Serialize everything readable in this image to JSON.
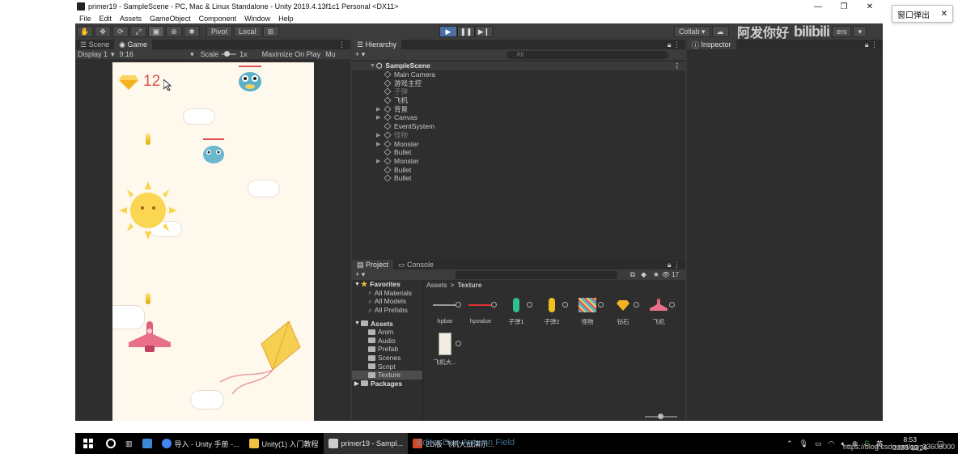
{
  "window": {
    "title": "primer19 - SampleScene - PC, Mac & Linux Standalone - Unity 2019.4.13f1c1 Personal <DX11>",
    "minimize": "—",
    "restore": "❐",
    "close": "✕"
  },
  "popout": {
    "label": "窗口弹出",
    "close": "✕"
  },
  "menu": [
    "File",
    "Edit",
    "Assets",
    "GameObject",
    "Component",
    "Window",
    "Help"
  ],
  "toolbar": {
    "pivot": "Pivot",
    "local": "Local",
    "collab": "Collab ▾",
    "layers": "ers",
    "layout": "▾"
  },
  "watermark": {
    "text": "阿发你好",
    "logo": "bilibili"
  },
  "game_tabs": {
    "scene": "Scene",
    "game": "Game"
  },
  "game_options": {
    "display": "Display 1",
    "aspect": "9:16",
    "scale_label": "Scale",
    "scale_value": "1x",
    "maximize": "Maximize On Play",
    "mute": "Mu"
  },
  "game": {
    "score": "12"
  },
  "hierarchy": {
    "tab": "Hierarchy",
    "search_placeholder": "All",
    "scene": "SampleScene",
    "items": [
      {
        "label": "Main Camera",
        "arrow": "",
        "dim": false
      },
      {
        "label": "游戏主控",
        "arrow": "",
        "dim": false
      },
      {
        "label": "子弹",
        "arrow": "",
        "dim": true
      },
      {
        "label": "飞机",
        "arrow": "",
        "dim": false
      },
      {
        "label": "背景",
        "arrow": "▶",
        "dim": false
      },
      {
        "label": "Canvas",
        "arrow": "▶",
        "dim": false
      },
      {
        "label": "EventSystem",
        "arrow": "",
        "dim": false
      },
      {
        "label": "怪物",
        "arrow": "▶",
        "dim": true
      },
      {
        "label": "Monster",
        "arrow": "▶",
        "dim": false
      },
      {
        "label": "Bullet",
        "arrow": "",
        "dim": false
      },
      {
        "label": "Monster",
        "arrow": "▶",
        "dim": false
      },
      {
        "label": "Bullet",
        "arrow": "",
        "dim": false
      },
      {
        "label": "Bullet",
        "arrow": "",
        "dim": false
      }
    ]
  },
  "inspector": {
    "tab": "Inspector"
  },
  "project": {
    "tab_project": "Project",
    "tab_console": "Console",
    "count": "17",
    "favorites": "Favorites",
    "favorite_items": [
      "All Materials",
      "All Models",
      "All Prefabs"
    ],
    "assets": "Assets",
    "asset_folders": [
      "Anim",
      "Audio",
      "Prefab",
      "Scenes",
      "Script",
      "Texture"
    ],
    "packages": "Packages",
    "breadcrumb_root": "Assets",
    "breadcrumb_sep": ">",
    "breadcrumb_current": "Texture",
    "files": [
      "hpbar",
      "hpvalue",
      "子弹1",
      "子弹2",
      "怪物",
      "钻石",
      "飞机",
      "飞机大..."
    ]
  },
  "taskbar": {
    "items": [
      {
        "label": "导入 - Unity 手册 -...",
        "color": "#4285f4"
      },
      {
        "label": "Unity(1) 入门教程",
        "color": "#f0c040"
      },
      {
        "label": "primer19 - Sampl...",
        "color": "#cccccc"
      },
      {
        "label": "2D版 飞机大战演示...",
        "color": "#d04a2a"
      }
    ],
    "time": "8:53",
    "date": "2020/12/26",
    "csdn": "https://blog.csdn.net/qq_33608000"
  },
  "subtitle": "Editor Dice Autumn Field"
}
